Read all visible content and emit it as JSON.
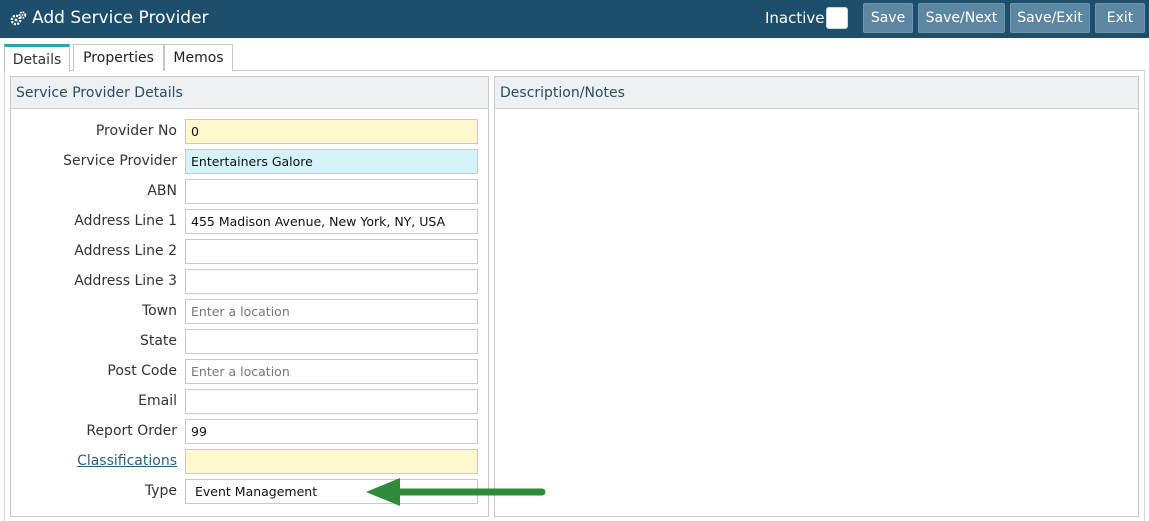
{
  "header": {
    "title": "Add Service Provider",
    "icon": "gears-icon",
    "inactive_label": "Inactive",
    "buttons": {
      "save": "Save",
      "save_next": "Save/Next",
      "save_exit": "Save/Exit",
      "exit": "Exit"
    },
    "background_color": "#1d4e6b"
  },
  "tabs": [
    {
      "label": "Details",
      "active": true
    },
    {
      "label": "Properties",
      "active": false
    },
    {
      "label": "Memos",
      "active": false
    }
  ],
  "left_panel": {
    "title": "Service Provider Details",
    "fields": {
      "provider_no": {
        "label": "Provider No",
        "value": "0"
      },
      "service_provider": {
        "label": "Service Provider",
        "value": "Entertainers Galore"
      },
      "abn": {
        "label": "ABN",
        "value": ""
      },
      "address1": {
        "label": "Address Line 1",
        "value": "455 Madison Avenue, New York, NY, USA"
      },
      "address2": {
        "label": "Address Line 2",
        "value": ""
      },
      "address3": {
        "label": "Address Line 3",
        "value": ""
      },
      "town": {
        "label": "Town",
        "placeholder": "Enter a location"
      },
      "state": {
        "label": "State",
        "value": ""
      },
      "post_code": {
        "label": "Post Code",
        "placeholder": "Enter a location"
      },
      "email": {
        "label": "Email",
        "value": ""
      },
      "report_order": {
        "label": "Report Order",
        "value": "99"
      },
      "classifications": {
        "label": "Classifications",
        "value": ""
      },
      "type": {
        "label": "Type",
        "value": "Event Management"
      }
    }
  },
  "right_panel": {
    "title": "Description/Notes"
  },
  "annotation": {
    "arrow_color": "#2e8b3a"
  }
}
